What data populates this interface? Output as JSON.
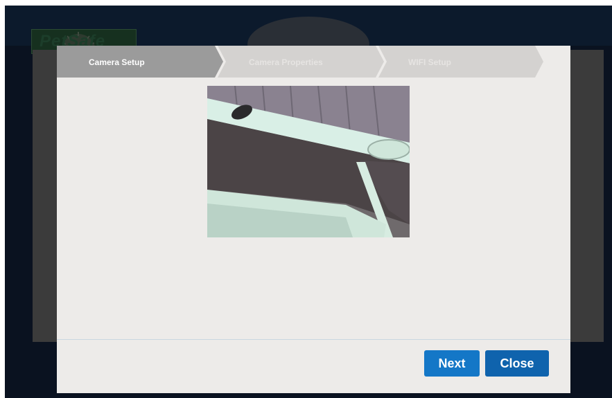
{
  "app": {
    "logo_text": "PetSafe"
  },
  "wizard": {
    "steps": [
      {
        "label": "Camera Setup",
        "state": "active"
      },
      {
        "label": "Camera Properties",
        "state": "inactive"
      },
      {
        "label": "WIFI Setup",
        "state": "inactive"
      }
    ]
  },
  "camera_preview": {
    "icon": "camera-feed-image"
  },
  "footer": {
    "next_label": "Next",
    "close_label": "Close"
  },
  "colors": {
    "step_active": "#9b9b9b",
    "step_inactive": "#d4d2d0",
    "button_next": "#1477c7",
    "button_close": "#0f63ad",
    "modal_bg": "#edebe9"
  }
}
